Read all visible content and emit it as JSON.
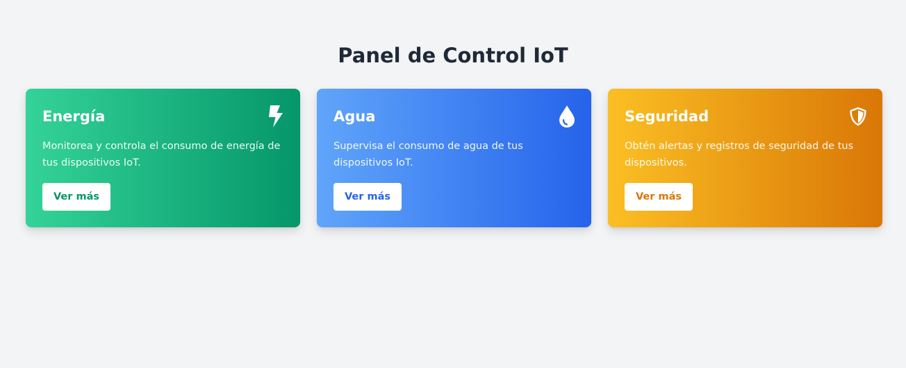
{
  "page": {
    "title": "Panel de Control IoT"
  },
  "cards": [
    {
      "title": "Energía",
      "description": "Monitorea y controla el consumo de energía de tus dispositivos IoT.",
      "button_label": "Ver más",
      "icon": "bolt-icon",
      "accent": "#059669"
    },
    {
      "title": "Agua",
      "description": "Supervisa el consumo de agua de tus dispositivos IoT.",
      "button_label": "Ver más",
      "icon": "water-drop-icon",
      "accent": "#2563eb"
    },
    {
      "title": "Seguridad",
      "description": "Obtén alertas y registros de seguridad de tus dispositivos.",
      "button_label": "Ver más",
      "icon": "shield-icon",
      "accent": "#d97706"
    }
  ]
}
